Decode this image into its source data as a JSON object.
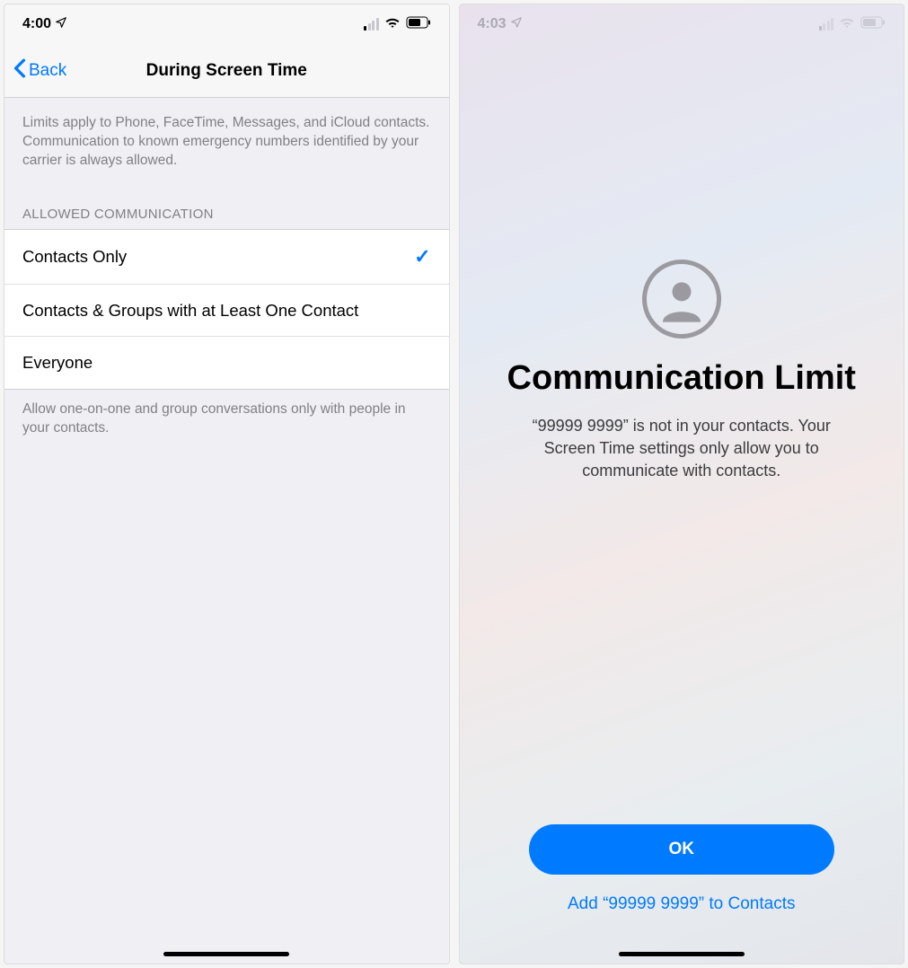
{
  "left": {
    "status": {
      "time": "4:00"
    },
    "nav": {
      "back": "Back",
      "title": "During Screen Time"
    },
    "description": "Limits apply to Phone, FaceTime, Messages, and iCloud contacts. Communication to known emergency numbers identified by your carrier is always allowed.",
    "section_header": "ALLOWED COMMUNICATION",
    "options": {
      "opt1": "Contacts Only",
      "opt2": "Contacts & Groups with at Least One Contact",
      "opt3": "Everyone"
    },
    "footer": "Allow one-on-one and group conversations only with people in your contacts."
  },
  "right": {
    "status": {
      "time": "4:03"
    },
    "title": "Communication Limit",
    "description": "“99999 9999” is not in your contacts. Your Screen Time settings only allow you to communicate with contacts.",
    "ok_label": "OK",
    "add_label": "Add “99999 9999” to Contacts"
  }
}
